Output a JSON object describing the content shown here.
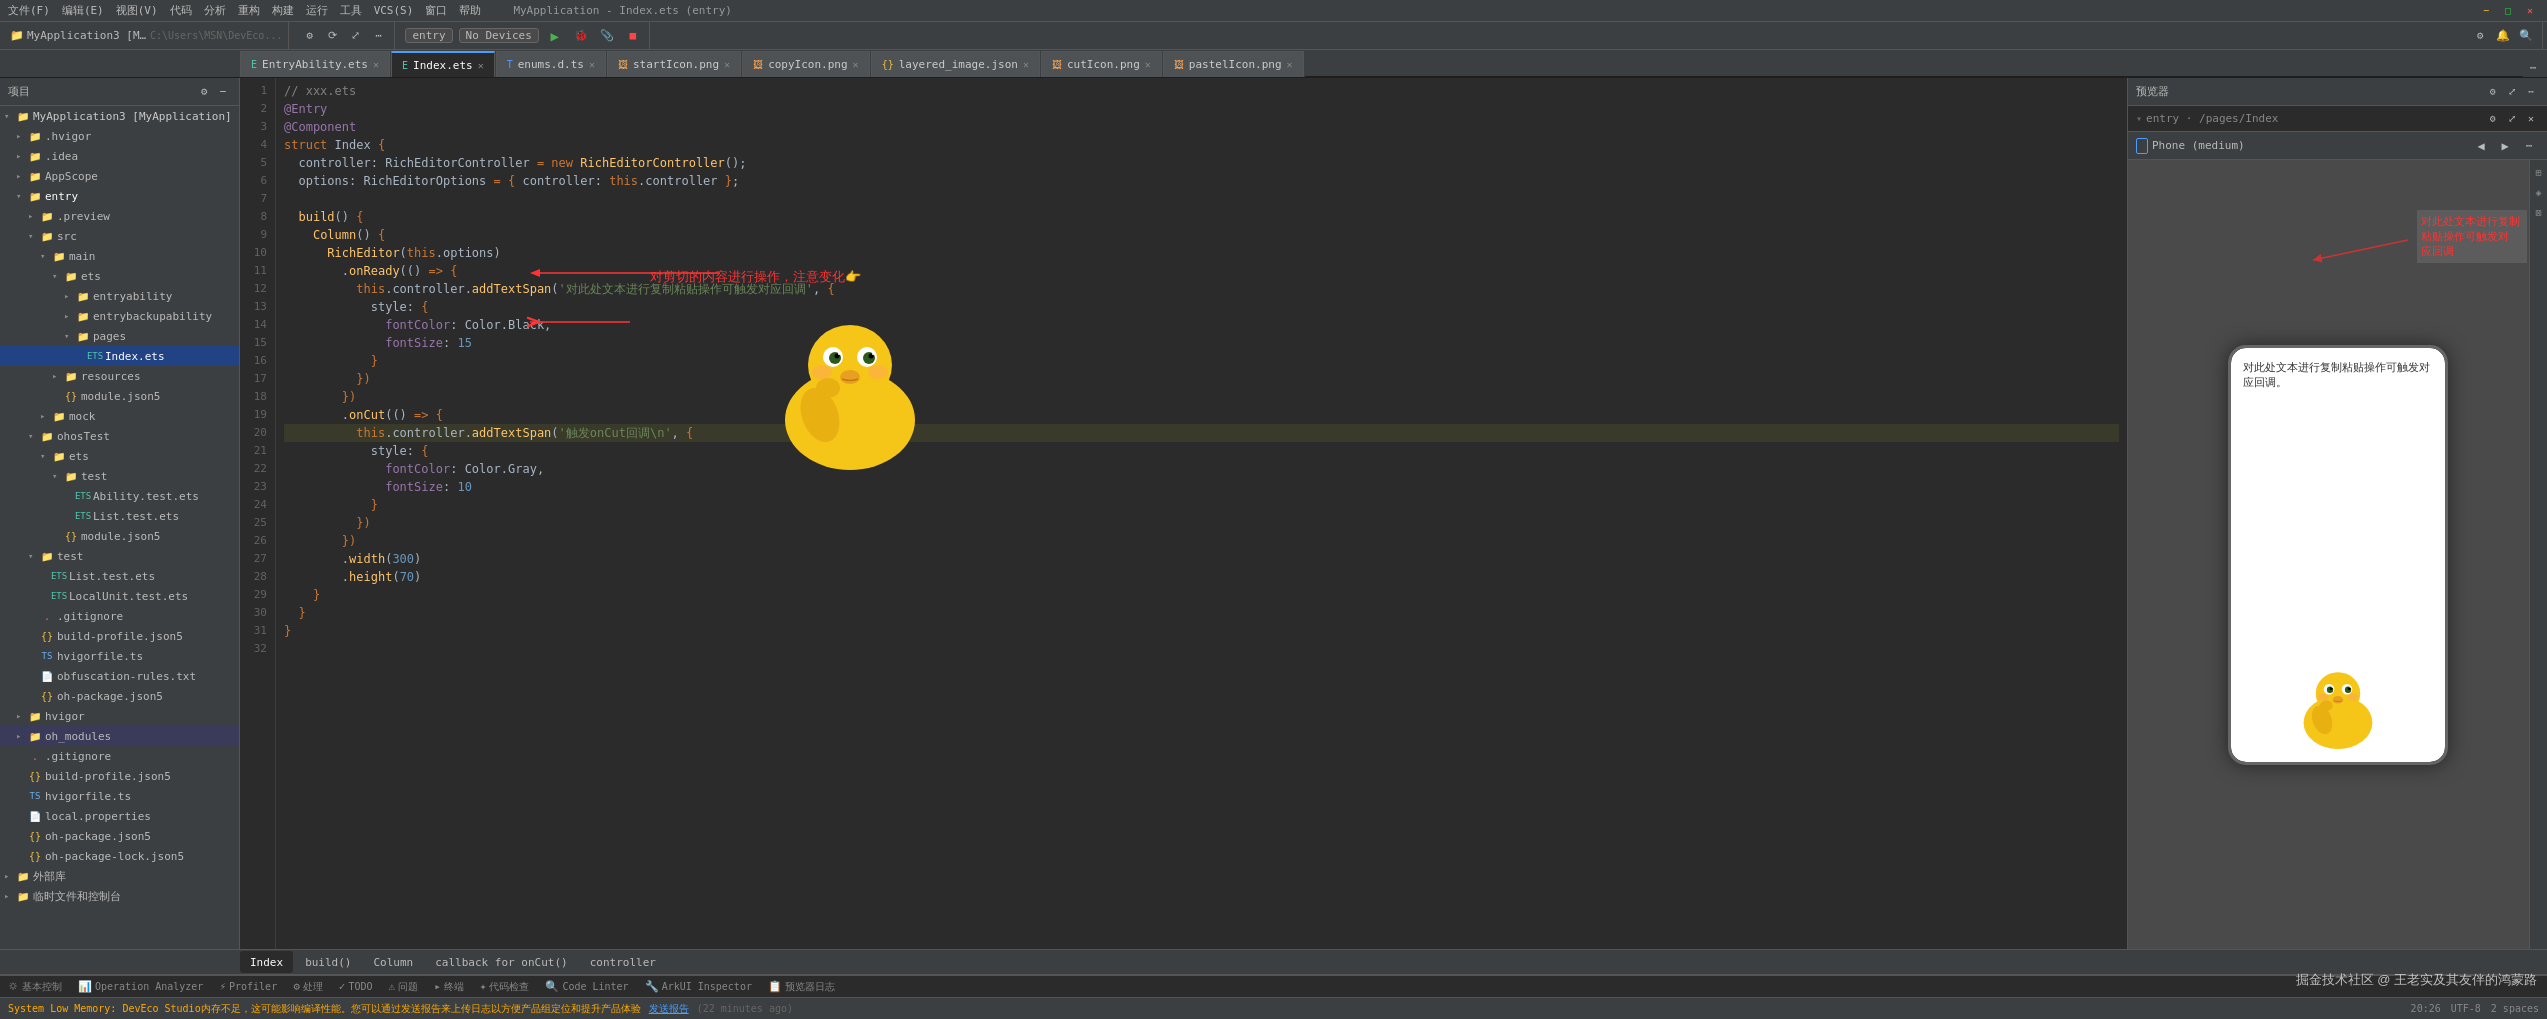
{
  "app": {
    "title": "MyApplication3 [MyApplication]",
    "path": "C:\\Users\\MSN\\DevEco...",
    "version": "DevEco Studio"
  },
  "menubar": {
    "items": [
      "文件(F)",
      "编辑(E)",
      "视图(V)",
      "代码",
      "分析",
      "重构",
      "构建",
      "运行",
      "工具",
      "VCS(S)",
      "窗口",
      "帮助",
      "MyApplication - Index.ets (entry)"
    ]
  },
  "toolbar": {
    "project_dropdown": "MyApplication3",
    "run_config": "entry",
    "device": "No Devices",
    "buttons": [
      "run",
      "debug",
      "attach",
      "stop"
    ]
  },
  "tabs": [
    {
      "label": "EntryAbility.ets",
      "active": false,
      "icon": "ets"
    },
    {
      "label": "Index.ets",
      "active": true,
      "icon": "ets"
    },
    {
      "label": "enums.d.ts",
      "active": false,
      "icon": "ts"
    },
    {
      "label": "startIcon.png",
      "active": false,
      "icon": "png"
    },
    {
      "label": "copyIcon.png",
      "active": false,
      "icon": "png"
    },
    {
      "label": "layered_image.json",
      "active": false,
      "icon": "json"
    },
    {
      "label": "cutIcon.png",
      "active": false,
      "icon": "png"
    },
    {
      "label": "pastelIcon.png",
      "active": false,
      "icon": "png"
    }
  ],
  "sidebar": {
    "header": "项目",
    "tree": [
      {
        "label": "MyApplication3 [MyApplication]",
        "level": 0,
        "type": "project",
        "expanded": true
      },
      {
        "label": ".hvigor",
        "level": 1,
        "type": "folder",
        "expanded": false
      },
      {
        "label": ".idea",
        "level": 1,
        "type": "folder",
        "expanded": false
      },
      {
        "label": "AppScope",
        "level": 1,
        "type": "folder",
        "expanded": false
      },
      {
        "label": "entry",
        "level": 1,
        "type": "folder",
        "expanded": true
      },
      {
        "label": ".preview",
        "level": 2,
        "type": "folder",
        "expanded": false
      },
      {
        "label": "src",
        "level": 2,
        "type": "folder",
        "expanded": true
      },
      {
        "label": "main",
        "level": 3,
        "type": "folder",
        "expanded": true
      },
      {
        "label": "ets",
        "level": 4,
        "type": "folder",
        "expanded": true
      },
      {
        "label": "entryability",
        "level": 5,
        "type": "folder",
        "expanded": false
      },
      {
        "label": "entrybackupability",
        "level": 5,
        "type": "folder",
        "expanded": false
      },
      {
        "label": "pages",
        "level": 5,
        "type": "folder",
        "expanded": true
      },
      {
        "label": "Index.ets",
        "level": 6,
        "type": "ets",
        "selected": true
      },
      {
        "label": "resources",
        "level": 4,
        "type": "folder",
        "expanded": false
      },
      {
        "label": "module.json5",
        "level": 4,
        "type": "json"
      },
      {
        "label": "mock",
        "level": 3,
        "type": "folder",
        "expanded": false
      },
      {
        "label": "ohosTest",
        "level": 2,
        "type": "folder",
        "expanded": true
      },
      {
        "label": "ets",
        "level": 3,
        "type": "folder",
        "expanded": true
      },
      {
        "label": "test",
        "level": 4,
        "type": "folder",
        "expanded": true
      },
      {
        "label": "Ability.test.ets",
        "level": 5,
        "type": "ets"
      },
      {
        "label": "List.test.ets",
        "level": 5,
        "type": "ets"
      },
      {
        "label": "module.json5",
        "level": 4,
        "type": "json"
      },
      {
        "label": "test",
        "level": 2,
        "type": "folder",
        "expanded": true
      },
      {
        "label": "List.test.ets",
        "level": 3,
        "type": "ets"
      },
      {
        "label": "LocalUnit.test.ets",
        "level": 3,
        "type": "ets"
      },
      {
        "label": ".gitignore",
        "level": 2,
        "type": "file"
      },
      {
        "label": "build-profile.json5",
        "level": 2,
        "type": "json"
      },
      {
        "label": "hvigorfile.ts",
        "level": 2,
        "type": "ts"
      },
      {
        "label": "obfuscation-rules.txt",
        "level": 2,
        "type": "file"
      },
      {
        "label": "oh-package.json5",
        "level": 2,
        "type": "json"
      },
      {
        "label": "hvigor",
        "level": 1,
        "type": "folder",
        "expanded": false
      },
      {
        "label": "oh_modules",
        "level": 1,
        "type": "folder",
        "expanded": false
      },
      {
        "label": ".gitignore",
        "level": 1,
        "type": "file"
      },
      {
        "label": "build-profile.json5",
        "level": 1,
        "type": "json"
      },
      {
        "label": "hvigorfile.ts",
        "level": 1,
        "type": "ts"
      },
      {
        "label": "local.properties",
        "level": 1,
        "type": "file"
      },
      {
        "label": "oh-package.json5",
        "level": 1,
        "type": "json"
      },
      {
        "label": "oh-package-lock.json5",
        "level": 1,
        "type": "json"
      },
      {
        "label": "外部库",
        "level": 0,
        "type": "folder",
        "expanded": false
      },
      {
        "label": "临时文件和控制台",
        "level": 0,
        "type": "folder",
        "expanded": false
      }
    ]
  },
  "editor": {
    "filename": "Index.ets",
    "lines": [
      {
        "num": 1,
        "code": "// xxx.ets"
      },
      {
        "num": 2,
        "code": "@Entry"
      },
      {
        "num": 3,
        "code": "@Component"
      },
      {
        "num": 4,
        "code": "struct Index {"
      },
      {
        "num": 5,
        "code": "  controller: RichEditorController = new RichEditorController();"
      },
      {
        "num": 6,
        "code": "  options: RichEditorOptions = { controller: this.controller };"
      },
      {
        "num": 7,
        "code": ""
      },
      {
        "num": 8,
        "code": "  build() {"
      },
      {
        "num": 9,
        "code": "    Column() {"
      },
      {
        "num": 10,
        "code": "      RichEditor(this.options)"
      },
      {
        "num": 11,
        "code": "        .onReady(() => {"
      },
      {
        "num": 12,
        "code": "          this.controller.addTextSpan('对此处文本进行复制粘贴操作可触发对应回调', {"
      },
      {
        "num": 13,
        "code": "            style: {"
      },
      {
        "num": 14,
        "code": "              fontColor: Color.Black,"
      },
      {
        "num": 15,
        "code": "              fontSize: 15"
      },
      {
        "num": 16,
        "code": "            }"
      },
      {
        "num": 17,
        "code": "          })"
      },
      {
        "num": 18,
        "code": "        })"
      },
      {
        "num": 19,
        "code": "        .onCut(() => {"
      },
      {
        "num": 20,
        "code": "          this.controller.addTextSpan('触发onCut回调\\n', {"
      },
      {
        "num": 21,
        "code": "            style: {"
      },
      {
        "num": 22,
        "code": "              fontColor: Color.Gray,"
      },
      {
        "num": 23,
        "code": "              fontSize: 10"
      },
      {
        "num": 24,
        "code": "            }"
      },
      {
        "num": 25,
        "code": "          })"
      },
      {
        "num": 26,
        "code": "        })"
      },
      {
        "num": 27,
        "code": "        .width(300)"
      },
      {
        "num": 28,
        "code": "        .height(70)"
      },
      {
        "num": 29,
        "code": "    }"
      },
      {
        "num": 30,
        "code": "  }"
      },
      {
        "num": 31,
        "code": "}"
      },
      {
        "num": 32,
        "code": ""
      }
    ]
  },
  "preview": {
    "header": "预览器",
    "path": "entry · /pages/Index",
    "device": "Phone (medium)",
    "phone_text": "对此处文本进行复制粘贴操作可触发对应回调。",
    "annotation1": "对此处文本进行复制粘贴操作可触发对\n应回调",
    "annotation2": "对剪切的内容进行操作，注意变化👉"
  },
  "bottom_tabs": [
    {
      "label": "Index",
      "active": true
    },
    {
      "label": "build()",
      "active": false
    },
    {
      "label": "Column",
      "active": false
    },
    {
      "label": "callback for onCut()",
      "active": false
    },
    {
      "label": "controller",
      "active": false
    }
  ],
  "status_bar": {
    "memory": "System Low Memory: DevEco Studio内存不足，这可能影响编译性能。您可以通过发送报告来上传日志以方便产品组定位和提升产品体验",
    "send": "发送报告",
    "time_ago": "(22 minutes ago)",
    "right": {
      "line_col": "20:26",
      "encoding": "UTF-8",
      "indent": "2 spaces"
    }
  },
  "bottom_toolbar": {
    "items": [
      {
        "label": "基本控制",
        "icon": "▶"
      },
      {
        "label": "Operation Analyzer",
        "icon": "📊"
      },
      {
        "label": "Profiler",
        "icon": "⚡"
      },
      {
        "label": "处理",
        "icon": "⚙"
      },
      {
        "label": "TODO",
        "icon": "✓"
      },
      {
        "label": "问题",
        "icon": "⚠"
      },
      {
        "label": "终端",
        "icon": ">"
      },
      {
        "label": "代码检查",
        "icon": "✦"
      },
      {
        "label": "Code Linter",
        "icon": "🔍"
      },
      {
        "label": "ArkUI Inspector",
        "icon": "🔧"
      },
      {
        "label": "预览器日志",
        "icon": "📋"
      }
    ]
  },
  "watermark": "掘金技术社区 @ 王老实及其友伴的鸿蒙路",
  "icons": {
    "no_devices": "No Devices",
    "run_config": "entry"
  }
}
